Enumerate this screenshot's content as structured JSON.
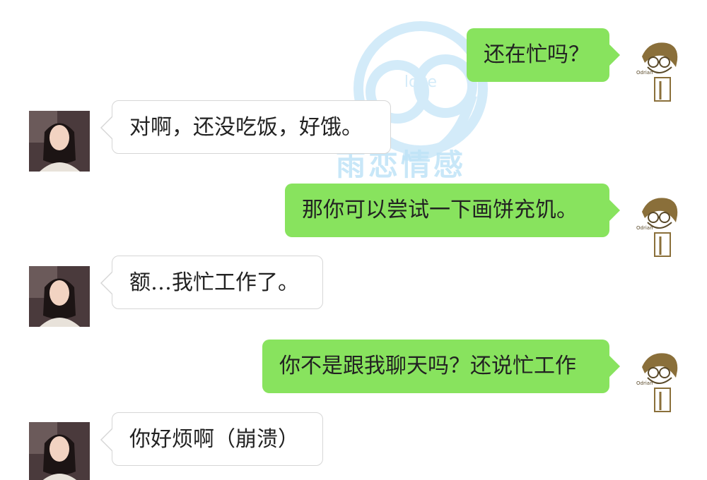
{
  "watermark": {
    "logo_number": "69",
    "logo_word": "love",
    "brand_text": "雨恋情感"
  },
  "messages": [
    {
      "side": "right",
      "text": "还在忙吗？"
    },
    {
      "side": "left",
      "text": "对啊，还没吃饭，好饿。"
    },
    {
      "side": "right",
      "text": "那你可以尝试一下画饼充饥。"
    },
    {
      "side": "left",
      "text": "额…我忙工作了。"
    },
    {
      "side": "right",
      "text": "你不是跟我聊天吗？还说忙工作"
    },
    {
      "side": "left",
      "text": "你好烦啊（崩溃）"
    }
  ],
  "avatar_right_signature": "Odrian",
  "colors": {
    "sent_bubble": "#88e35e",
    "received_bubble": "#ffffff",
    "watermark": "#bfe3f7"
  }
}
